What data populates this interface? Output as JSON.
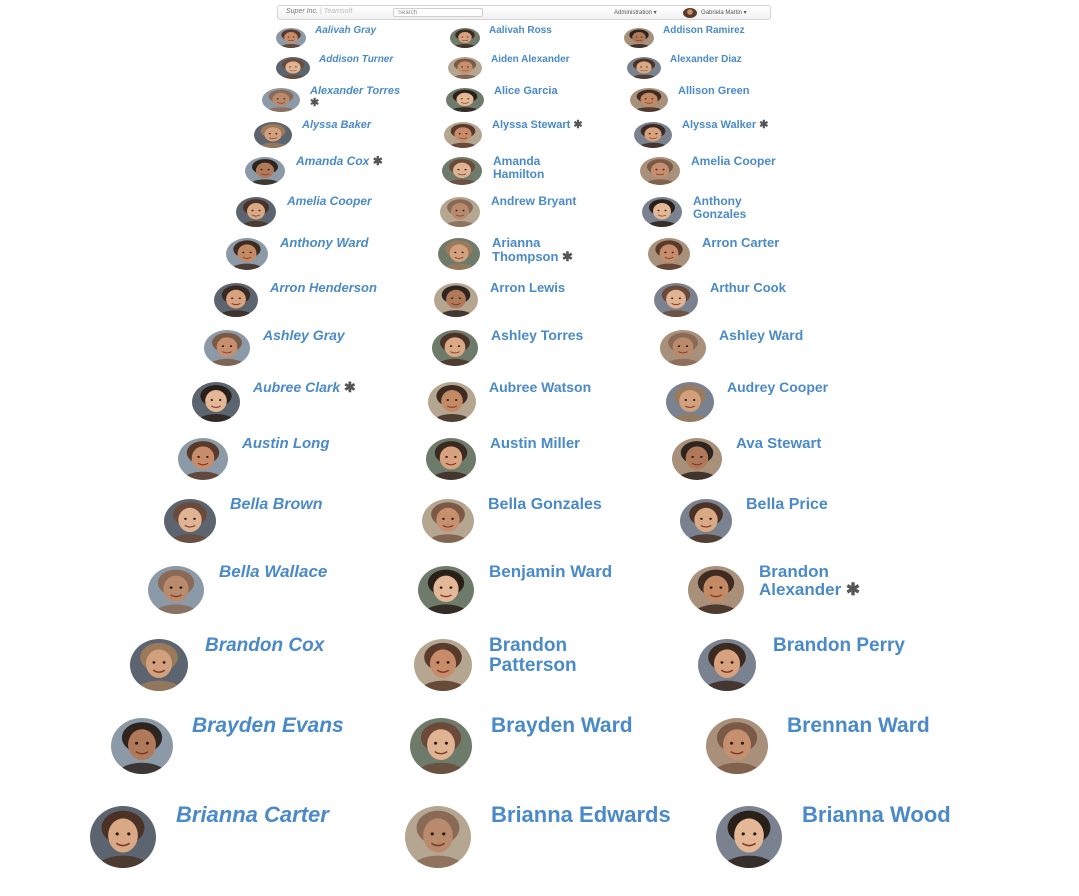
{
  "topbar": {
    "brand": "Super Inc.",
    "separator": "|",
    "team": "Teamsoft",
    "search_placeholder": "Search",
    "admin_menu": "Administration ▾",
    "user_name": "Gabriela Martin ▾"
  },
  "star_glyph": "✱",
  "columns": [
    [
      {
        "name": "Aalivah Gray",
        "starred": false
      },
      {
        "name": "Addison Turner",
        "starred": false
      },
      {
        "name": "Alexander Torres",
        "starred": true
      },
      {
        "name": "Alyssa Baker",
        "starred": false
      },
      {
        "name": "Amanda Cox",
        "starred": true
      },
      {
        "name": "Amelia Cooper",
        "starred": false
      },
      {
        "name": "Anthony Ward",
        "starred": false
      },
      {
        "name": "Arron Henderson",
        "starred": false
      },
      {
        "name": "Ashley Gray",
        "starred": false
      },
      {
        "name": "Aubree Clark",
        "starred": true
      },
      {
        "name": "Austin Long",
        "starred": false
      },
      {
        "name": "Bella Brown",
        "starred": false
      },
      {
        "name": "Bella Wallace",
        "starred": false
      },
      {
        "name": "Brandon Cox",
        "starred": false
      },
      {
        "name": "Brayden Evans",
        "starred": false
      },
      {
        "name": "Brianna Carter",
        "starred": false
      }
    ],
    [
      {
        "name": "Aalivah Ross",
        "starred": false
      },
      {
        "name": "Aiden Alexander",
        "starred": false
      },
      {
        "name": "Alice Garcia",
        "starred": false
      },
      {
        "name": "Alyssa Stewart",
        "starred": true
      },
      {
        "name": "Amanda Hamilton",
        "starred": false
      },
      {
        "name": "Andrew Bryant",
        "starred": false
      },
      {
        "name": "Arianna Thompson",
        "starred": true
      },
      {
        "name": "Arron Lewis",
        "starred": false
      },
      {
        "name": "Ashley Torres",
        "starred": false
      },
      {
        "name": "Aubree Watson",
        "starred": false
      },
      {
        "name": "Austin Miller",
        "starred": false
      },
      {
        "name": "Bella Gonzales",
        "starred": false
      },
      {
        "name": "Benjamin Ward",
        "starred": false
      },
      {
        "name": "Brandon Patterson",
        "starred": false
      },
      {
        "name": "Brayden Ward",
        "starred": false
      },
      {
        "name": "Brianna Edwards",
        "starred": false
      }
    ],
    [
      {
        "name": "Addison Ramirez",
        "starred": false
      },
      {
        "name": "Alexander Diaz",
        "starred": false
      },
      {
        "name": "Allison Green",
        "starred": false
      },
      {
        "name": "Alyssa Walker",
        "starred": true
      },
      {
        "name": "Amelia Cooper",
        "starred": false
      },
      {
        "name": "Anthony Gonzales",
        "starred": false
      },
      {
        "name": "Arron Carter",
        "starred": false
      },
      {
        "name": "Arthur Cook",
        "starred": false
      },
      {
        "name": "Ashley Ward",
        "starred": false
      },
      {
        "name": "Audrey Cooper",
        "starred": false
      },
      {
        "name": "Ava Stewart",
        "starred": false
      },
      {
        "name": "Bella Price",
        "starred": false
      },
      {
        "name": "Brandon Alexander",
        "starred": true
      },
      {
        "name": "Brandon Perry",
        "starred": false
      },
      {
        "name": "Brennan Ward",
        "starred": false
      },
      {
        "name": "Brianna Wood",
        "starred": false
      }
    ]
  ],
  "colors": {
    "link": "#4a8ac8",
    "star": "#555555",
    "rule": "#e3e3e3"
  }
}
